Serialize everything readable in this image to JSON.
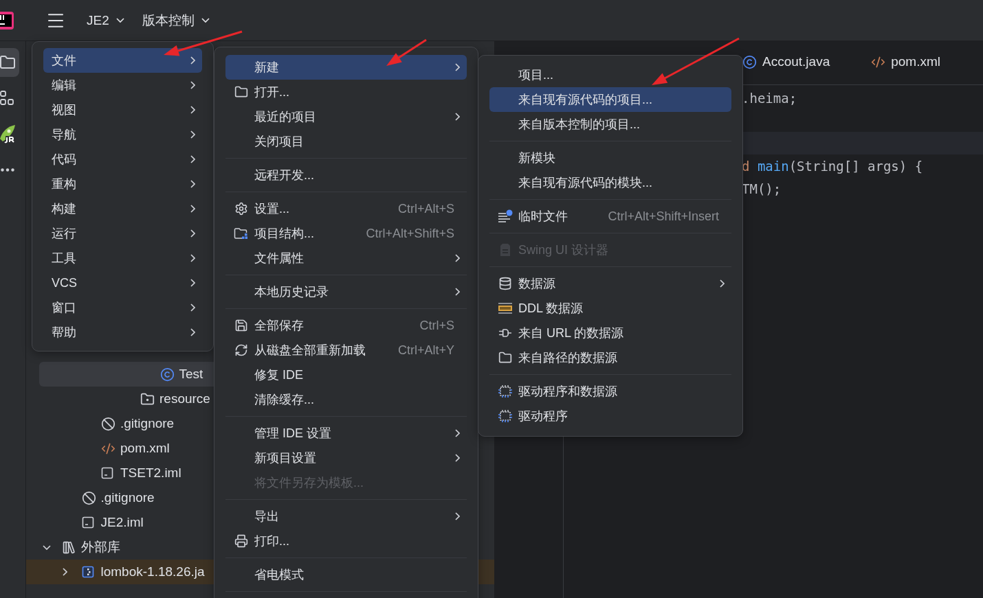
{
  "top_bar": {
    "project": "JE2",
    "vcs": "版本控制"
  },
  "tool_strip": [
    {
      "selected": true
    },
    {
      "selected": false
    },
    {
      "selected": false
    },
    {
      "selected": false
    }
  ],
  "project_tree": [
    {
      "children": [
        {
          "children": [
            {
              "children": [
                {
                  "children": [
                    {
                      "children": [
                        {
                          "label": "Test",
                          "kind": "class",
                          "selected": true,
                          "highlighted": false
                        }
                      ]
                    },
                    {
                      "label": "resource",
                      "kind": "resource-folder",
                      "selected": false,
                      "highlighted": false
                    }
                  ]
                }
              ]
            },
            {
              "label": ".gitignore",
              "kind": "ignore",
              "selected": false,
              "highlighted": false
            },
            {
              "label": "pom.xml",
              "kind": "xml",
              "selected": false,
              "highlighted": false
            },
            {
              "label": "TSET2.iml",
              "kind": "iml",
              "selected": false,
              "highlighted": false
            }
          ]
        },
        {
          "label": ".gitignore",
          "kind": "ignore",
          "selected": false,
          "highlighted": false
        },
        {
          "label": "JE2.iml",
          "kind": "iml",
          "selected": false,
          "highlighted": false
        }
      ]
    },
    {
      "label": "外部库",
      "kind": "library",
      "expanded": true,
      "selected": false,
      "highlighted": false,
      "children": [
        {
          "label": "lombok-1.18.26.ja",
          "kind": "jar",
          "expanded": false,
          "selected": false,
          "highlighted": true
        }
      ]
    }
  ],
  "editor": {
    "tabs": [
      {
        "label": "Accout.java",
        "kind": "class",
        "selected": false
      },
      {
        "label": "pom.xml",
        "kind": "xml",
        "selected": false
      }
    ],
    "code_lines": [
      {
        "current": false,
        "tokens": [
          {
            "text": ".heima;",
            "kind": "plain"
          }
        ]
      },
      {
        "current": false
      },
      {
        "current": true
      },
      {
        "current": false,
        "tokens": [
          {
            "text": "d",
            "kind": "keyword"
          },
          {
            "text": "main",
            "kind": "function",
            "space_before": true
          },
          {
            "text": "(String[] args) {",
            "kind": "plain"
          }
        ]
      },
      {
        "current": false,
        "tokens": [
          {
            "text": "TM();",
            "kind": "plain"
          }
        ]
      }
    ]
  },
  "menus": [
    {
      "items": [
        {
          "kind": "item",
          "label": "文件",
          "submenu": true,
          "selected": true,
          "disabled": false
        },
        {
          "kind": "item",
          "label": "编辑",
          "submenu": true,
          "selected": false,
          "disabled": false
        },
        {
          "kind": "item",
          "label": "视图",
          "submenu": true,
          "selected": false,
          "disabled": false
        },
        {
          "kind": "item",
          "label": "导航",
          "submenu": true,
          "selected": false,
          "disabled": false
        },
        {
          "kind": "item",
          "label": "代码",
          "submenu": true,
          "selected": false,
          "disabled": false
        },
        {
          "kind": "item",
          "label": "重构",
          "submenu": true,
          "selected": false,
          "disabled": false
        },
        {
          "kind": "item",
          "label": "构建",
          "submenu": true,
          "selected": false,
          "disabled": false
        },
        {
          "kind": "item",
          "label": "运行",
          "submenu": true,
          "selected": false,
          "disabled": false
        },
        {
          "kind": "item",
          "label": "工具",
          "submenu": true,
          "selected": false,
          "disabled": false
        },
        {
          "kind": "item",
          "label": "VCS",
          "submenu": true,
          "selected": false,
          "disabled": false
        },
        {
          "kind": "item",
          "label": "窗口",
          "submenu": true,
          "selected": false,
          "disabled": false
        },
        {
          "kind": "item",
          "label": "帮助",
          "submenu": true,
          "selected": false,
          "disabled": false
        }
      ]
    },
    {
      "items": [
        {
          "kind": "item",
          "label": "新建",
          "submenu": true,
          "selected": true,
          "disabled": false
        },
        {
          "kind": "item",
          "label": "打开...",
          "submenu": false,
          "selected": false,
          "disabled": false
        },
        {
          "kind": "item",
          "label": "最近的项目",
          "submenu": true,
          "selected": false,
          "disabled": false
        },
        {
          "kind": "item",
          "label": "关闭项目",
          "submenu": false,
          "selected": false,
          "disabled": false
        },
        {
          "kind": "separator"
        },
        {
          "kind": "item",
          "label": "远程开发...",
          "submenu": false,
          "selected": false,
          "disabled": false
        },
        {
          "kind": "separator"
        },
        {
          "kind": "item",
          "label": "设置...",
          "shortcut": "Ctrl+Alt+S",
          "submenu": false,
          "selected": false,
          "disabled": false
        },
        {
          "kind": "item",
          "label": "项目结构...",
          "shortcut": "Ctrl+Alt+Shift+S",
          "submenu": false,
          "selected": false,
          "disabled": false
        },
        {
          "kind": "item",
          "label": "文件属性",
          "submenu": true,
          "selected": false,
          "disabled": false
        },
        {
          "kind": "separator"
        },
        {
          "kind": "item",
          "label": "本地历史记录",
          "submenu": true,
          "selected": false,
          "disabled": false
        },
        {
          "kind": "separator"
        },
        {
          "kind": "item",
          "label": "全部保存",
          "shortcut": "Ctrl+S",
          "submenu": false,
          "selected": false,
          "disabled": false
        },
        {
          "kind": "item",
          "label": "从磁盘全部重新加载",
          "shortcut": "Ctrl+Alt+Y",
          "submenu": false,
          "selected": false,
          "disabled": false
        },
        {
          "kind": "item",
          "label": "修复 IDE",
          "submenu": false,
          "selected": false,
          "disabled": false
        },
        {
          "kind": "item",
          "label": "清除缓存...",
          "submenu": false,
          "selected": false,
          "disabled": false
        },
        {
          "kind": "separator"
        },
        {
          "kind": "item",
          "label": "管理 IDE 设置",
          "submenu": true,
          "selected": false,
          "disabled": false
        },
        {
          "kind": "item",
          "label": "新项目设置",
          "submenu": true,
          "selected": false,
          "disabled": false
        },
        {
          "kind": "item",
          "label": "将文件另存为模板...",
          "submenu": false,
          "selected": false,
          "disabled": true
        },
        {
          "kind": "separator"
        },
        {
          "kind": "item",
          "label": "导出",
          "submenu": true,
          "selected": false,
          "disabled": false
        },
        {
          "kind": "item",
          "label": "打印...",
          "submenu": false,
          "selected": false,
          "disabled": false
        },
        {
          "kind": "separator"
        },
        {
          "kind": "item",
          "label": "省电模式",
          "submenu": false,
          "selected": false,
          "disabled": false
        },
        {
          "kind": "separator"
        }
      ]
    },
    {
      "items": [
        {
          "kind": "item",
          "label": "项目...",
          "submenu": false,
          "selected": false,
          "disabled": false
        },
        {
          "kind": "item",
          "label": "来自现有源代码的项目...",
          "submenu": false,
          "selected": true,
          "disabled": false
        },
        {
          "kind": "item",
          "label": "来自版本控制的项目...",
          "submenu": false,
          "selected": false,
          "disabled": false
        },
        {
          "kind": "separator"
        },
        {
          "kind": "item",
          "label": "新模块",
          "submenu": false,
          "selected": false,
          "disabled": false
        },
        {
          "kind": "item",
          "label": "来自现有源代码的模块...",
          "submenu": false,
          "selected": false,
          "disabled": false
        },
        {
          "kind": "separator"
        },
        {
          "kind": "item",
          "label": "临时文件",
          "shortcut": "Ctrl+Alt+Shift+Insert",
          "submenu": false,
          "selected": false,
          "disabled": false
        },
        {
          "kind": "separator"
        },
        {
          "kind": "item",
          "label": "Swing UI 设计器",
          "submenu": false,
          "selected": false,
          "disabled": true
        },
        {
          "kind": "separator"
        },
        {
          "kind": "item",
          "label": "数据源",
          "submenu": true,
          "selected": false,
          "disabled": false
        },
        {
          "kind": "item",
          "label": "DDL 数据源",
          "submenu": false,
          "selected": false,
          "disabled": false
        },
        {
          "kind": "item",
          "label": "来自 URL 的数据源",
          "submenu": false,
          "selected": false,
          "disabled": false
        },
        {
          "kind": "item",
          "label": "来自路径的数据源",
          "submenu": false,
          "selected": false,
          "disabled": false
        },
        {
          "kind": "separator"
        },
        {
          "kind": "item",
          "label": "驱动程序和数据源",
          "submenu": false,
          "selected": false,
          "disabled": false
        },
        {
          "kind": "item",
          "label": "驱动程序",
          "submenu": false,
          "selected": false,
          "disabled": false
        }
      ]
    }
  ]
}
